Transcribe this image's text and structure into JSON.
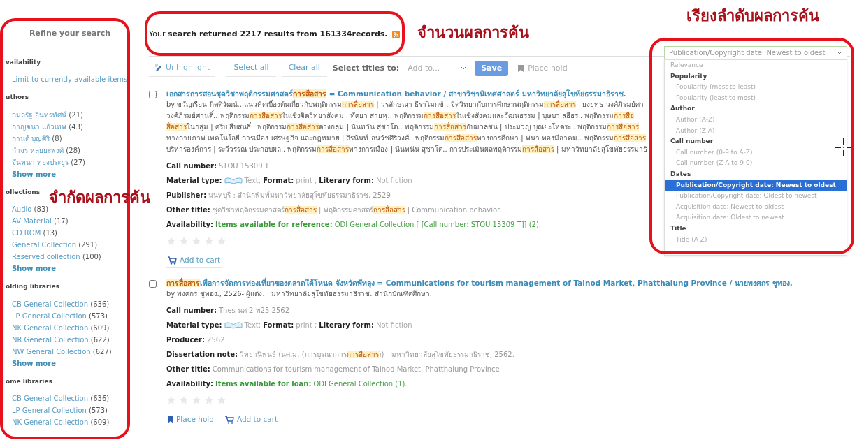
{
  "sidebar": {
    "title": "Refine your search",
    "groups": [
      {
        "heading": "vailability",
        "items": [
          {
            "label": "Limit to currently available items"
          }
        ]
      },
      {
        "heading": "uthors",
        "items": [
          {
            "label": "กมลรัฐ อินทรทัศน์",
            "count": "(21)"
          },
          {
            "label": "กาญจนา แก้วเทพ",
            "count": "(43)"
          },
          {
            "label": "กานต์ บุญศิริ",
            "count": "(8)"
          },
          {
            "label": "กำจร หลุยยะพงศ์",
            "count": "(28)"
          },
          {
            "label": "จันทนา ทองประยูร",
            "count": "(27)"
          }
        ],
        "show_more": "Show more"
      },
      {
        "heading": "ollections",
        "items": [
          {
            "label": "Audio",
            "count": "(83)"
          },
          {
            "label": "AV Material",
            "count": "(17)"
          },
          {
            "label": "CD ROM",
            "count": "(13)"
          },
          {
            "label": "General Collection",
            "count": "(291)"
          },
          {
            "label": "Reserved collection",
            "count": "(100)"
          }
        ],
        "show_more": "Show more"
      },
      {
        "heading": "olding libraries",
        "items": [
          {
            "label": "CB General Collection",
            "count": "(636)"
          },
          {
            "label": "LP General Collection",
            "count": "(573)"
          },
          {
            "label": "NK General Collection",
            "count": "(609)"
          },
          {
            "label": "NR General Collection",
            "count": "(622)"
          },
          {
            "label": "NW General Collection",
            "count": "(627)"
          }
        ],
        "show_more": "Show more"
      },
      {
        "heading": "ome libraries",
        "items": [
          {
            "label": "CB General Collection",
            "count": "(636)"
          },
          {
            "label": "LP General Collection",
            "count": "(573)"
          },
          {
            "label": "NK General Collection",
            "count": "(609)"
          }
        ]
      }
    ]
  },
  "results_header": {
    "summary": "Your **search returned 2217 results from 161334records.**"
  },
  "toolbar": {
    "unhighlight": "Unhighlight",
    "select_all": "Select all",
    "clear_all": "Clear all",
    "select_titles_label": "Select titles to:",
    "add_to": "Add to...",
    "save": "Save",
    "place_hold": "Place hold"
  },
  "results": [
    {
      "checked": false,
      "title": [
        {
          "text": "เอกสารการสอนชุดวิชาพฤติกรรมศาสตร์",
          "highlighted": false
        },
        {
          "text": "การสื่อสาร",
          "highlighted": true
        },
        {
          "text": " = Communication behavior / สาขาวิชานิเทศศาสตร์ มหาวิทยาลัยสุโขทัยธรรมาธิราช.",
          "highlighted": false
        }
      ],
      "byline_lines": [
        [
          {
            "text": "by ขวัญเรือน กิตติวัฒน์.. แนวคิดเบื้องต้นเกี่ยวกับพฤติกรรม",
            "highlighted": false
          },
          {
            "text": "การสื่อสาร",
            "highlighted": true
          },
          {
            "text": " | วรลักษณา ธีราโมกข์.. จิตวิทยากับการศึกษาพฤติกรรม",
            "highlighted": false
          },
          {
            "text": "การสื่อสาร",
            "highlighted": true
          },
          {
            "text": " | ยงยุทธ วงศ์ภิรมย์ศา",
            "highlighted": false
          }
        ],
        [
          {
            "text": "วงศ์ภิรมย์ศานติ์.. พฤติกรรม",
            "highlighted": false
          },
          {
            "text": "การสื่อสาร",
            "highlighted": true
          },
          {
            "text": "ในเชิงจิตวิทยาสังคม | ทัศยา สายหุ.. พฤติกรรม",
            "highlighted": false
          },
          {
            "text": "การสื่อสาร",
            "highlighted": true
          },
          {
            "text": "ในเชิงสังคมและวัฒนธรรม | บุษบา สธีธร.. พฤติกรรม",
            "highlighted": false
          },
          {
            "text": "การสื่อ",
            "highlighted": true
          }
        ],
        [
          {
            "text": "สื่อสาร",
            "highlighted": true
          },
          {
            "text": "ในกลุ่ม | ศรีบ สืบสนธิ์.. พฤติกรรม",
            "highlighted": false
          },
          {
            "text": "การสื่อสาร",
            "highlighted": true
          },
          {
            "text": "ต่างกลุ่ม | นันทวัน สุชาโต.. พฤติกรรม",
            "highlighted": false
          },
          {
            "text": "การสื่อสาร",
            "highlighted": true
          },
          {
            "text": "กับมวลชน | ประมวญ บุณยะโหตระ.. พฤติกรรม",
            "highlighted": false
          },
          {
            "text": "การสื่อสาร",
            "highlighted": true
          }
        ],
        [
          {
            "text": "ทางกายภาพ เทคโนโลยี การเมือง เศรษฐกิจ และกฎหมาย | ถิรนันท์ อนวัชศิริวงศ์.. พฤติกรรม",
            "highlighted": false
          },
          {
            "text": "การสื่อสาร",
            "highlighted": true
          },
          {
            "text": "ทางการศึกษา | พนา ทองมีอาคม.. พฤติกรรม",
            "highlighted": false
          },
          {
            "text": "การสื่อสาร",
            "highlighted": true
          }
        ],
        [
          {
            "text": "บริหารองค์การ | ระวีวรรณ ประกอบผล.. พฤติกรรม",
            "highlighted": false
          },
          {
            "text": "การสื่อสาร",
            "highlighted": true
          },
          {
            "text": "ทางการเมือง | นันทนัน สุชาโต.. การประเมินผลพฤติกรรม",
            "highlighted": false
          },
          {
            "text": "การสื่อสาร",
            "highlighted": true
          },
          {
            "text": " | มหาวิทยาลัยสุโขทัยธรรมาธิ",
            "highlighted": false
          }
        ]
      ],
      "fields": [
        {
          "kind": "text",
          "label": "Call number:",
          "value": [
            {
              "text": "STOU 15309 T",
              "highlighted": false
            }
          ]
        },
        {
          "kind": "material",
          "label": "Material type:",
          "type": "Text;",
          "format_label": "Format:",
          "format": "print ;",
          "form_label": "Literary form:",
          "form": "Not fiction"
        },
        {
          "kind": "text",
          "label": "Publisher:",
          "value": [
            {
              "text": "นนทบุรี : สำนักพิมพ์มหาวิทยาลัยสุโขทัยธรรมาธิราช, 2529",
              "highlighted": false
            }
          ]
        },
        {
          "kind": "text",
          "label": "Other title:",
          "value": [
            {
              "text": "ชุดวิชาพฤติกรรมศาสตร์",
              "highlighted": false
            },
            {
              "text": "การสื่อสาร",
              "highlighted": true
            },
            {
              "text": " | พฤติกรรมศาสตร์",
              "highlighted": false
            },
            {
              "text": "การสื่อสาร",
              "highlighted": true
            },
            {
              "text": " | Communication behavior.",
              "highlighted": false
            }
          ]
        },
        {
          "kind": "availability",
          "label": "Availability:",
          "status": "Items available for reference:",
          "value": "ODI General Collection [ [Call number: STOU 15309 T]] (2)."
        }
      ],
      "stars": 0,
      "actions": [
        {
          "kind": "cart",
          "label": "Add to cart"
        }
      ]
    },
    {
      "checked": false,
      "title": [
        {
          "text": "การสื่อสาร",
          "highlighted": true
        },
        {
          "text": "เพื่อการจัดการท่องเที่ยวของตลาดใต้โหนด จังหวัดพัทลุง = Communications for tourism management of Tainod Market, Phatthalung Province / นายพงศกร ชูทอง.",
          "highlighted": false
        }
      ],
      "byline_lines": [
        [
          {
            "text": "by พงศกร ชูทอง., 2526- ผู้แต่ง. | มหาวิทยาลัยสุโขทัยธรรมาธิราช. สำนักบัณฑิตศึกษา.",
            "highlighted": false
          }
        ]
      ],
      "fields": [
        {
          "kind": "text",
          "label": "Call number:",
          "value": [
            {
              "text": "Thes นศ 2 พ25 2562",
              "highlighted": false
            }
          ]
        },
        {
          "kind": "material",
          "label": "Material type:",
          "type": "Text;",
          "format_label": "Format:",
          "format": "print ;",
          "form_label": "Literary form:",
          "form": "Not fiction"
        },
        {
          "kind": "text",
          "label": "Producer:",
          "value": [
            {
              "text": "2562",
              "highlighted": false
            }
          ]
        },
        {
          "kind": "text",
          "label": "Dissertation note:",
          "value": [
            {
              "text": "วิทยานิพนธ์ (นศ.ม. (การบูรณาการ",
              "highlighted": false
            },
            {
              "text": "การสื่อสาร",
              "highlighted": true
            },
            {
              "text": "))-- มหาวิทยาลัยสุโขทัยธรรมาธิราช, 2562.",
              "highlighted": false
            }
          ]
        },
        {
          "kind": "text",
          "label": "Other title:",
          "value": [
            {
              "text": "Communications for tourism management of Tainod Market, Phatthalung Province .",
              "highlighted": false
            }
          ]
        },
        {
          "kind": "availability",
          "label": "Availability:",
          "status": "Items available for loan:",
          "value": "ODI General Collection (1)."
        }
      ],
      "stars": 0,
      "actions": [
        {
          "kind": "hold",
          "label": "Place hold"
        },
        {
          "kind": "cart",
          "label": "Add to cart"
        }
      ]
    }
  ],
  "sort": {
    "value": "Publication/Copyright date: Newest to oldest",
    "options": [
      {
        "kind": "option",
        "label": "Relevance",
        "selected": false
      },
      {
        "kind": "group",
        "label": "Popularity"
      },
      {
        "kind": "option",
        "label": "Popularity (most to least)",
        "selected": false
      },
      {
        "kind": "option",
        "label": "Popularity (least to most)",
        "selected": false
      },
      {
        "kind": "group",
        "label": "Author"
      },
      {
        "kind": "option",
        "label": "Author (A-Z)",
        "selected": false
      },
      {
        "kind": "option",
        "label": "Author (Z-A)",
        "selected": false
      },
      {
        "kind": "group",
        "label": "Call number"
      },
      {
        "kind": "option",
        "label": "Call number (0-9 to A-Z)",
        "selected": false
      },
      {
        "kind": "option",
        "label": "Call number (Z-A to 9-0)",
        "selected": false
      },
      {
        "kind": "group",
        "label": "Dates"
      },
      {
        "kind": "option",
        "label": "Publication/Copyright date: Newest to oldest",
        "selected": true
      },
      {
        "kind": "option",
        "label": "Publication/Copyright date: Oldest to newest",
        "selected": false
      },
      {
        "kind": "option",
        "label": "Acquisition date: Newest to oldest",
        "selected": false
      },
      {
        "kind": "option",
        "label": "Acquisition date: Oldest to newest",
        "selected": false
      },
      {
        "kind": "group",
        "label": "Title"
      },
      {
        "kind": "option",
        "label": "Title (A-Z)",
        "selected": false
      }
    ]
  },
  "annotations": [
    {
      "text": "จำนวนผลการค้น"
    },
    {
      "text": "จำกัดผลการค้น"
    },
    {
      "text": "เรียงลำดับผลการค้น"
    }
  ]
}
